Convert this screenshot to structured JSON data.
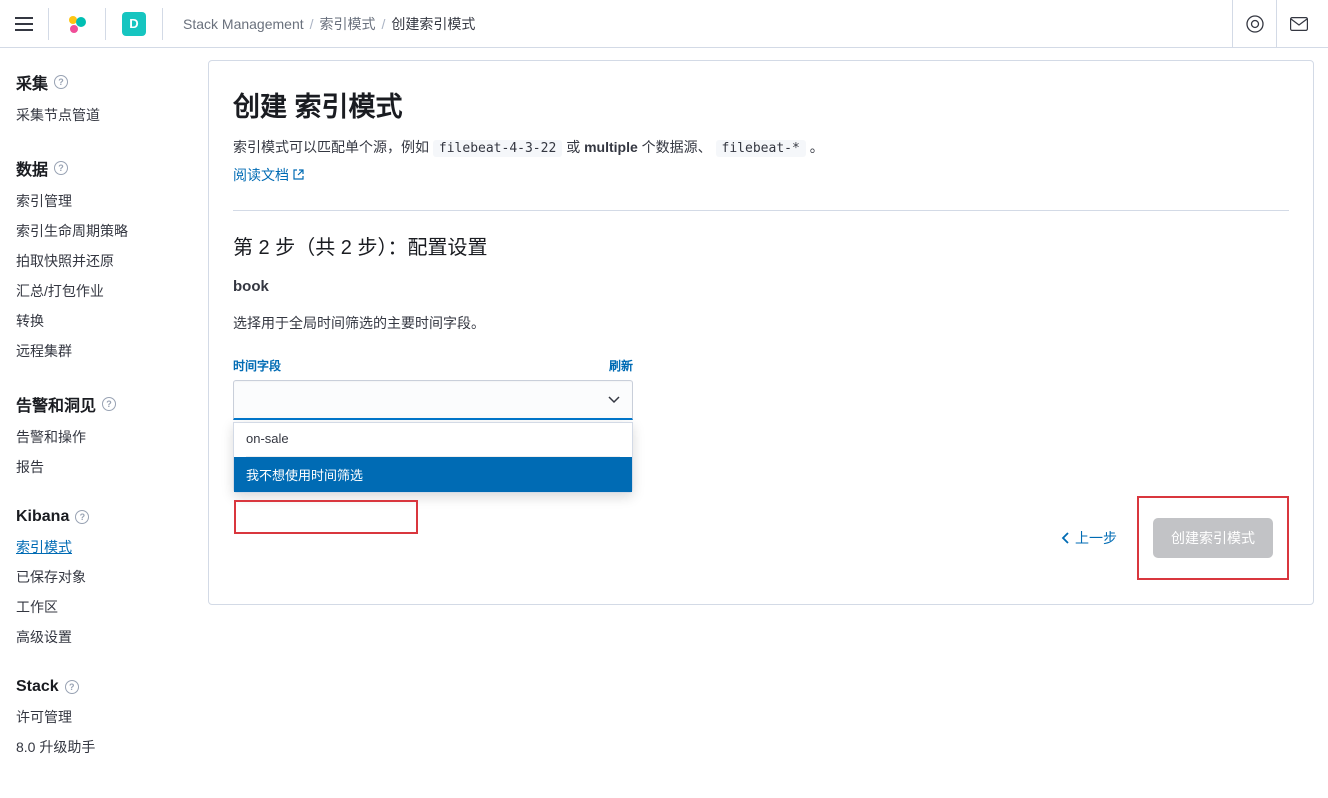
{
  "topbar": {
    "space_letter": "D",
    "breadcrumbs": [
      "Stack Management",
      "索引模式",
      "创建索引模式"
    ]
  },
  "sidebar": {
    "sections": [
      {
        "heading": "采集",
        "items": [
          "采集节点管道"
        ]
      },
      {
        "heading": "数据",
        "items": [
          "索引管理",
          "索引生命周期策略",
          "拍取快照并还原",
          "汇总/打包作业",
          "转换",
          "远程集群"
        ]
      },
      {
        "heading": "告警和洞见",
        "items": [
          "告警和操作",
          "报告"
        ]
      },
      {
        "heading": "Kibana",
        "items": [
          "索引模式",
          "已保存对象",
          "工作区",
          "高级设置"
        ],
        "active": "索引模式"
      },
      {
        "heading": "Stack",
        "items": [
          "许可管理",
          "8.0 升级助手"
        ]
      }
    ]
  },
  "panel": {
    "title": "创建 索引模式",
    "desc_prefix": "索引模式可以匹配单个源，例如 ",
    "code1": "filebeat-4-3-22",
    "desc_or": " 或 ",
    "desc_multiple": "multiple",
    "desc_suffix1": " 个数据源、 ",
    "code2": "filebeat-*",
    "desc_suffix2": " 。",
    "read_docs": "阅读文档",
    "step_title": "第 2 步（共 2 步）：配置设置",
    "pattern_name": "book",
    "subtext": "选择用于全局时间筛选的主要时间字段。",
    "field_label": "时间字段",
    "refresh": "刷新",
    "dropdown": {
      "options": [
        "on-sale",
        "我不想使用时间筛选"
      ],
      "selected_index": 1
    },
    "back_label": "上一步",
    "create_label": "创建索引模式"
  }
}
